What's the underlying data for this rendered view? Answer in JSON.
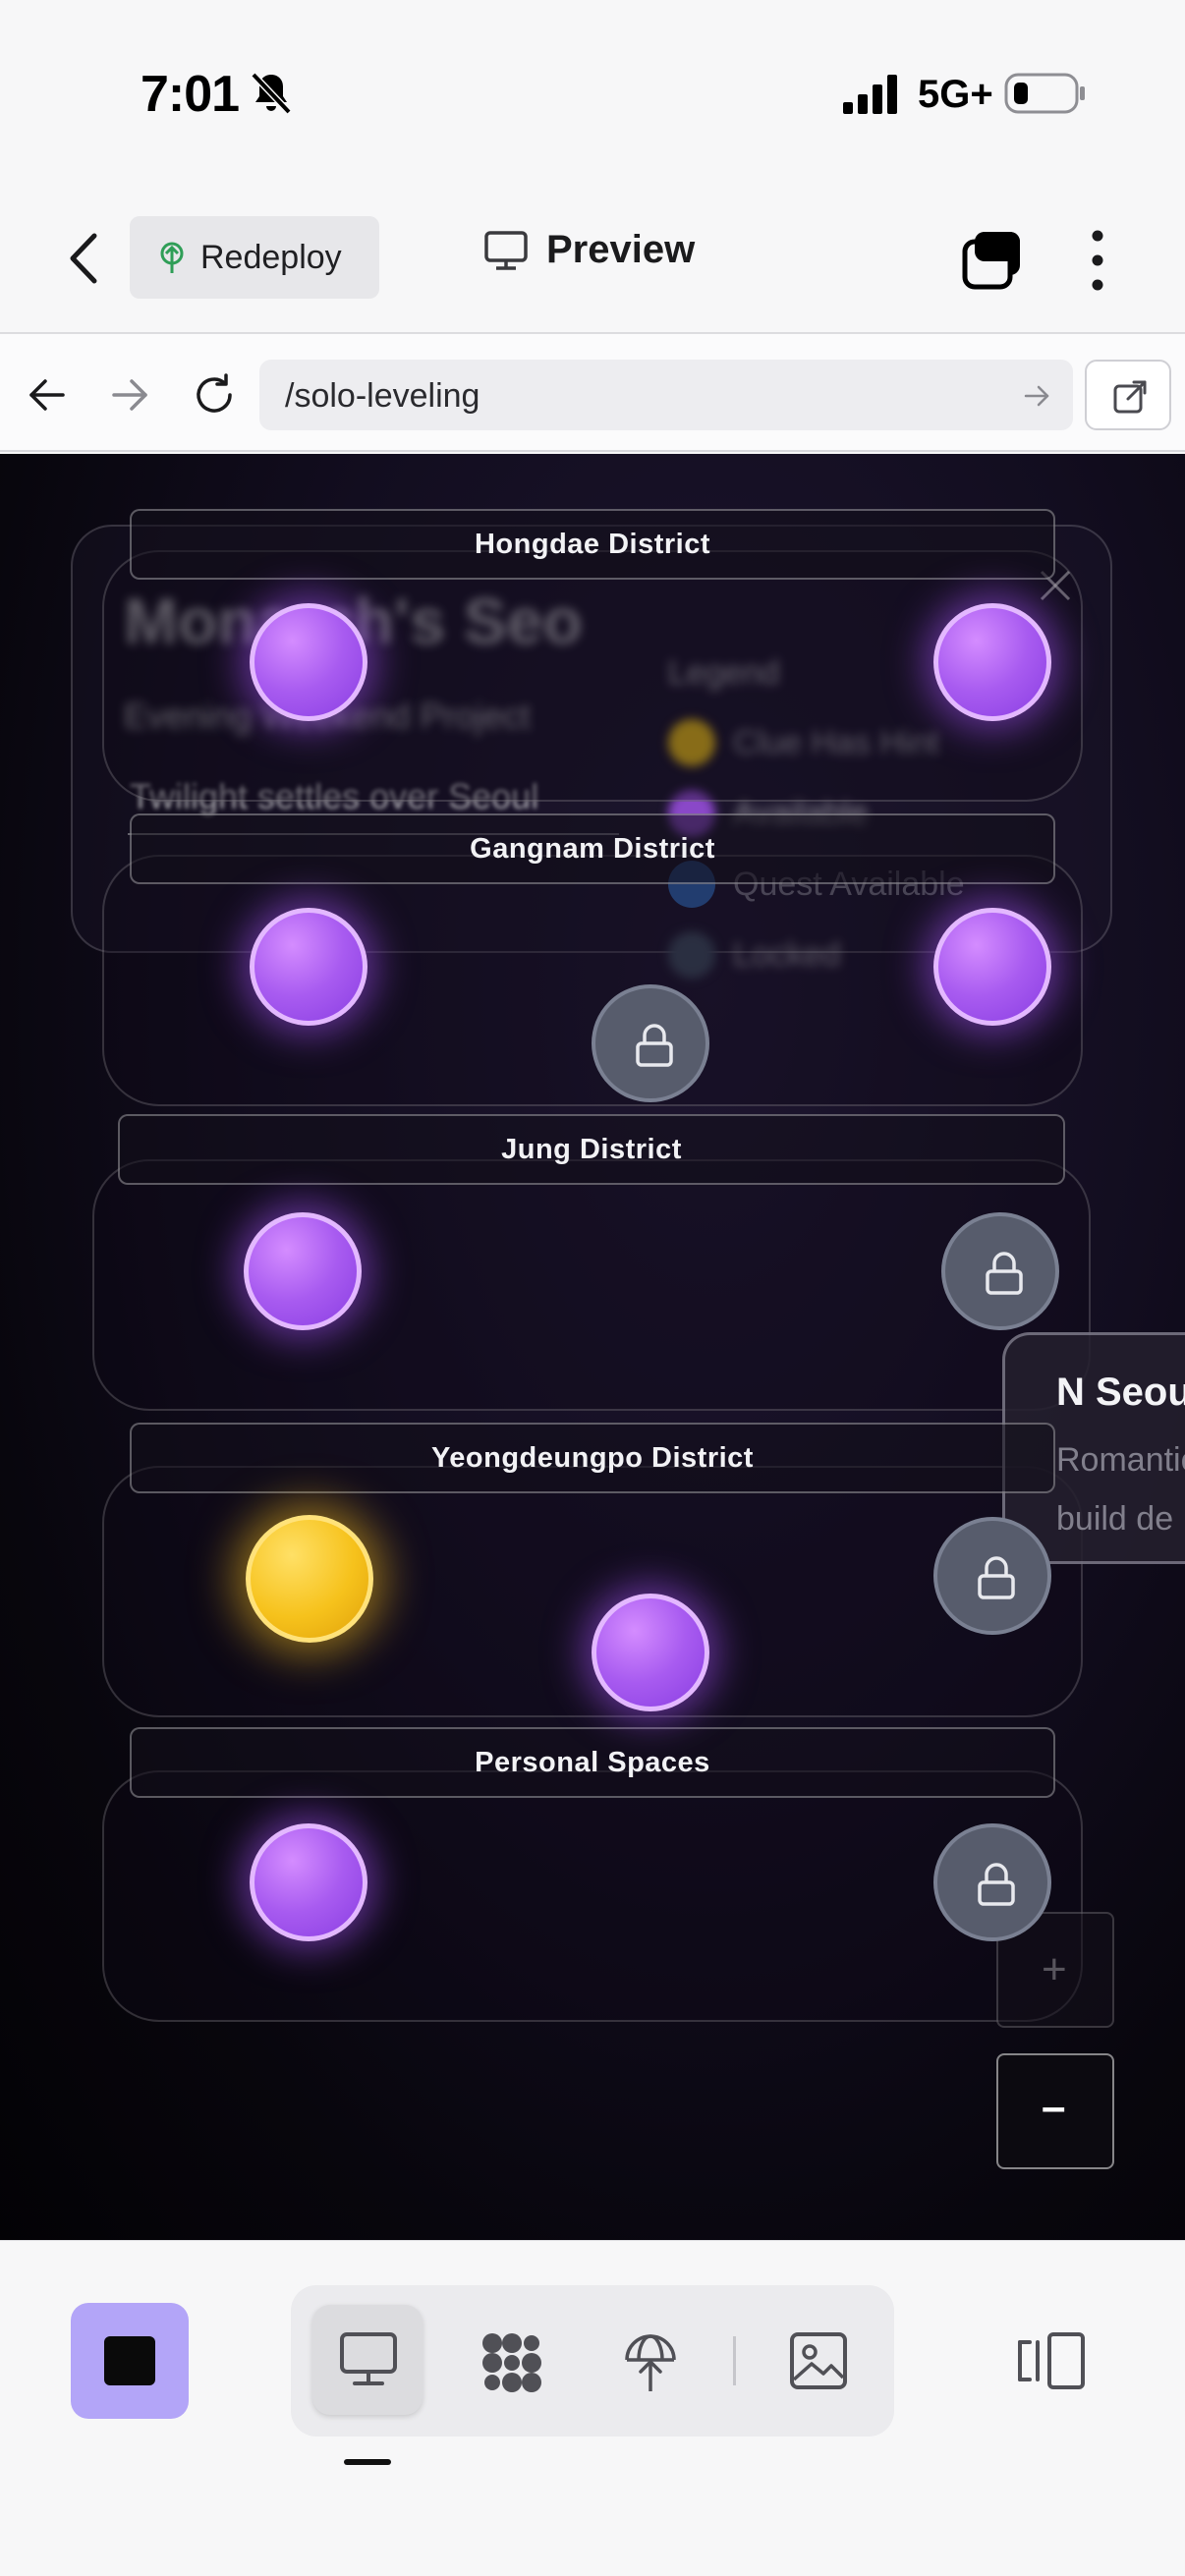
{
  "status": {
    "time": "7:01",
    "network": "5G+"
  },
  "header": {
    "redeploy_label": "Redeploy",
    "preview_label": "Preview"
  },
  "browser": {
    "url": "/solo-leveling"
  },
  "background_card": {
    "title": "Monarch's Seo",
    "subtitle": "Evening Weekend Project",
    "tagline": "Twilight settles over Seoul",
    "legend_title": "Legend",
    "legend": [
      {
        "label": "Clue Has Hint",
        "color": "#f6c21c"
      },
      {
        "label": "Available",
        "color": "#a85bf0"
      },
      {
        "label": "Quest Available",
        "color": "#2d5a9e"
      },
      {
        "label": "Locked",
        "color": "#4a5468"
      }
    ]
  },
  "districts": [
    {
      "name": "Hongdae District"
    },
    {
      "name": "Gangnam District"
    },
    {
      "name": "Jung District"
    },
    {
      "name": "Yeongdeungpo District"
    },
    {
      "name": "Personal Spaces"
    }
  ],
  "side_card": {
    "title": "N Seoul",
    "line1": "Romantic",
    "line2": "build de"
  },
  "zoom": {
    "in": "+",
    "out": "–"
  },
  "colors": {
    "available": "#a85bf0",
    "quest": "#f6c21c",
    "locked": "#575c6c",
    "accent": "#b3a5f8"
  },
  "toolbar": {
    "icons": [
      "monitor-icon",
      "dots-grid-icon",
      "deploy-icon",
      "image-icon",
      "panel-icon"
    ]
  }
}
